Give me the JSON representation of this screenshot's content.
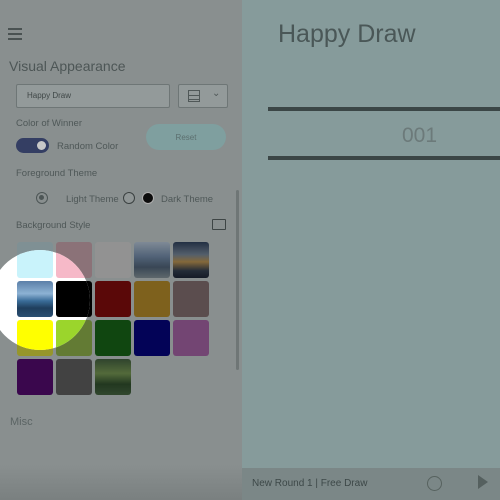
{
  "app": {
    "title": "Happy Draw",
    "number": "001",
    "status": "New Round 1 | Free Draw"
  },
  "settings": {
    "heading": "Visual Appearance",
    "draw_style_value": "Happy Draw",
    "color_of_winner_label": "Color of Winner",
    "random_color_label": "Random Color",
    "random_color_on": true,
    "reset_label": "Reset",
    "foreground_theme_label": "Foreground Theme",
    "light_theme_label": "Light Theme",
    "dark_theme_label": "Dark Theme",
    "selected_theme": "Light Theme",
    "background_style_label": "Background Style",
    "next_section_label": "Misc"
  },
  "swatches": [
    {
      "kind": "color",
      "color": "#c9f3fb"
    },
    {
      "kind": "color",
      "color": "#f6b9c8"
    },
    {
      "kind": "color",
      "color": "#f4f4f4"
    },
    {
      "kind": "image",
      "icon": "landscape-sky-image"
    },
    {
      "kind": "image",
      "icon": "landscape-sunset-image"
    },
    {
      "kind": "image",
      "icon": "landscape-lake-image"
    },
    {
      "kind": "color",
      "color": "#000000",
      "selected": true
    },
    {
      "kind": "color",
      "color": "#c40000"
    },
    {
      "kind": "color",
      "color": "#e6a000"
    },
    {
      "kind": "color",
      "color": "#a07f80"
    },
    {
      "kind": "color",
      "color": "#ffff00"
    },
    {
      "kind": "color",
      "color": "#9bd52c"
    },
    {
      "kind": "color",
      "color": "#008000"
    },
    {
      "kind": "color",
      "color": "#0000c8"
    },
    {
      "kind": "color",
      "color": "#d86ad8"
    },
    {
      "kind": "color",
      "color": "#7a00a8"
    },
    {
      "kind": "color",
      "color": "#6e6e6e"
    },
    {
      "kind": "image",
      "icon": "landscape-forest-image"
    }
  ],
  "colors": {
    "dim_overlay": "#868f8f",
    "toggle_on": "#343e63",
    "app_bg": "#869b9b"
  }
}
